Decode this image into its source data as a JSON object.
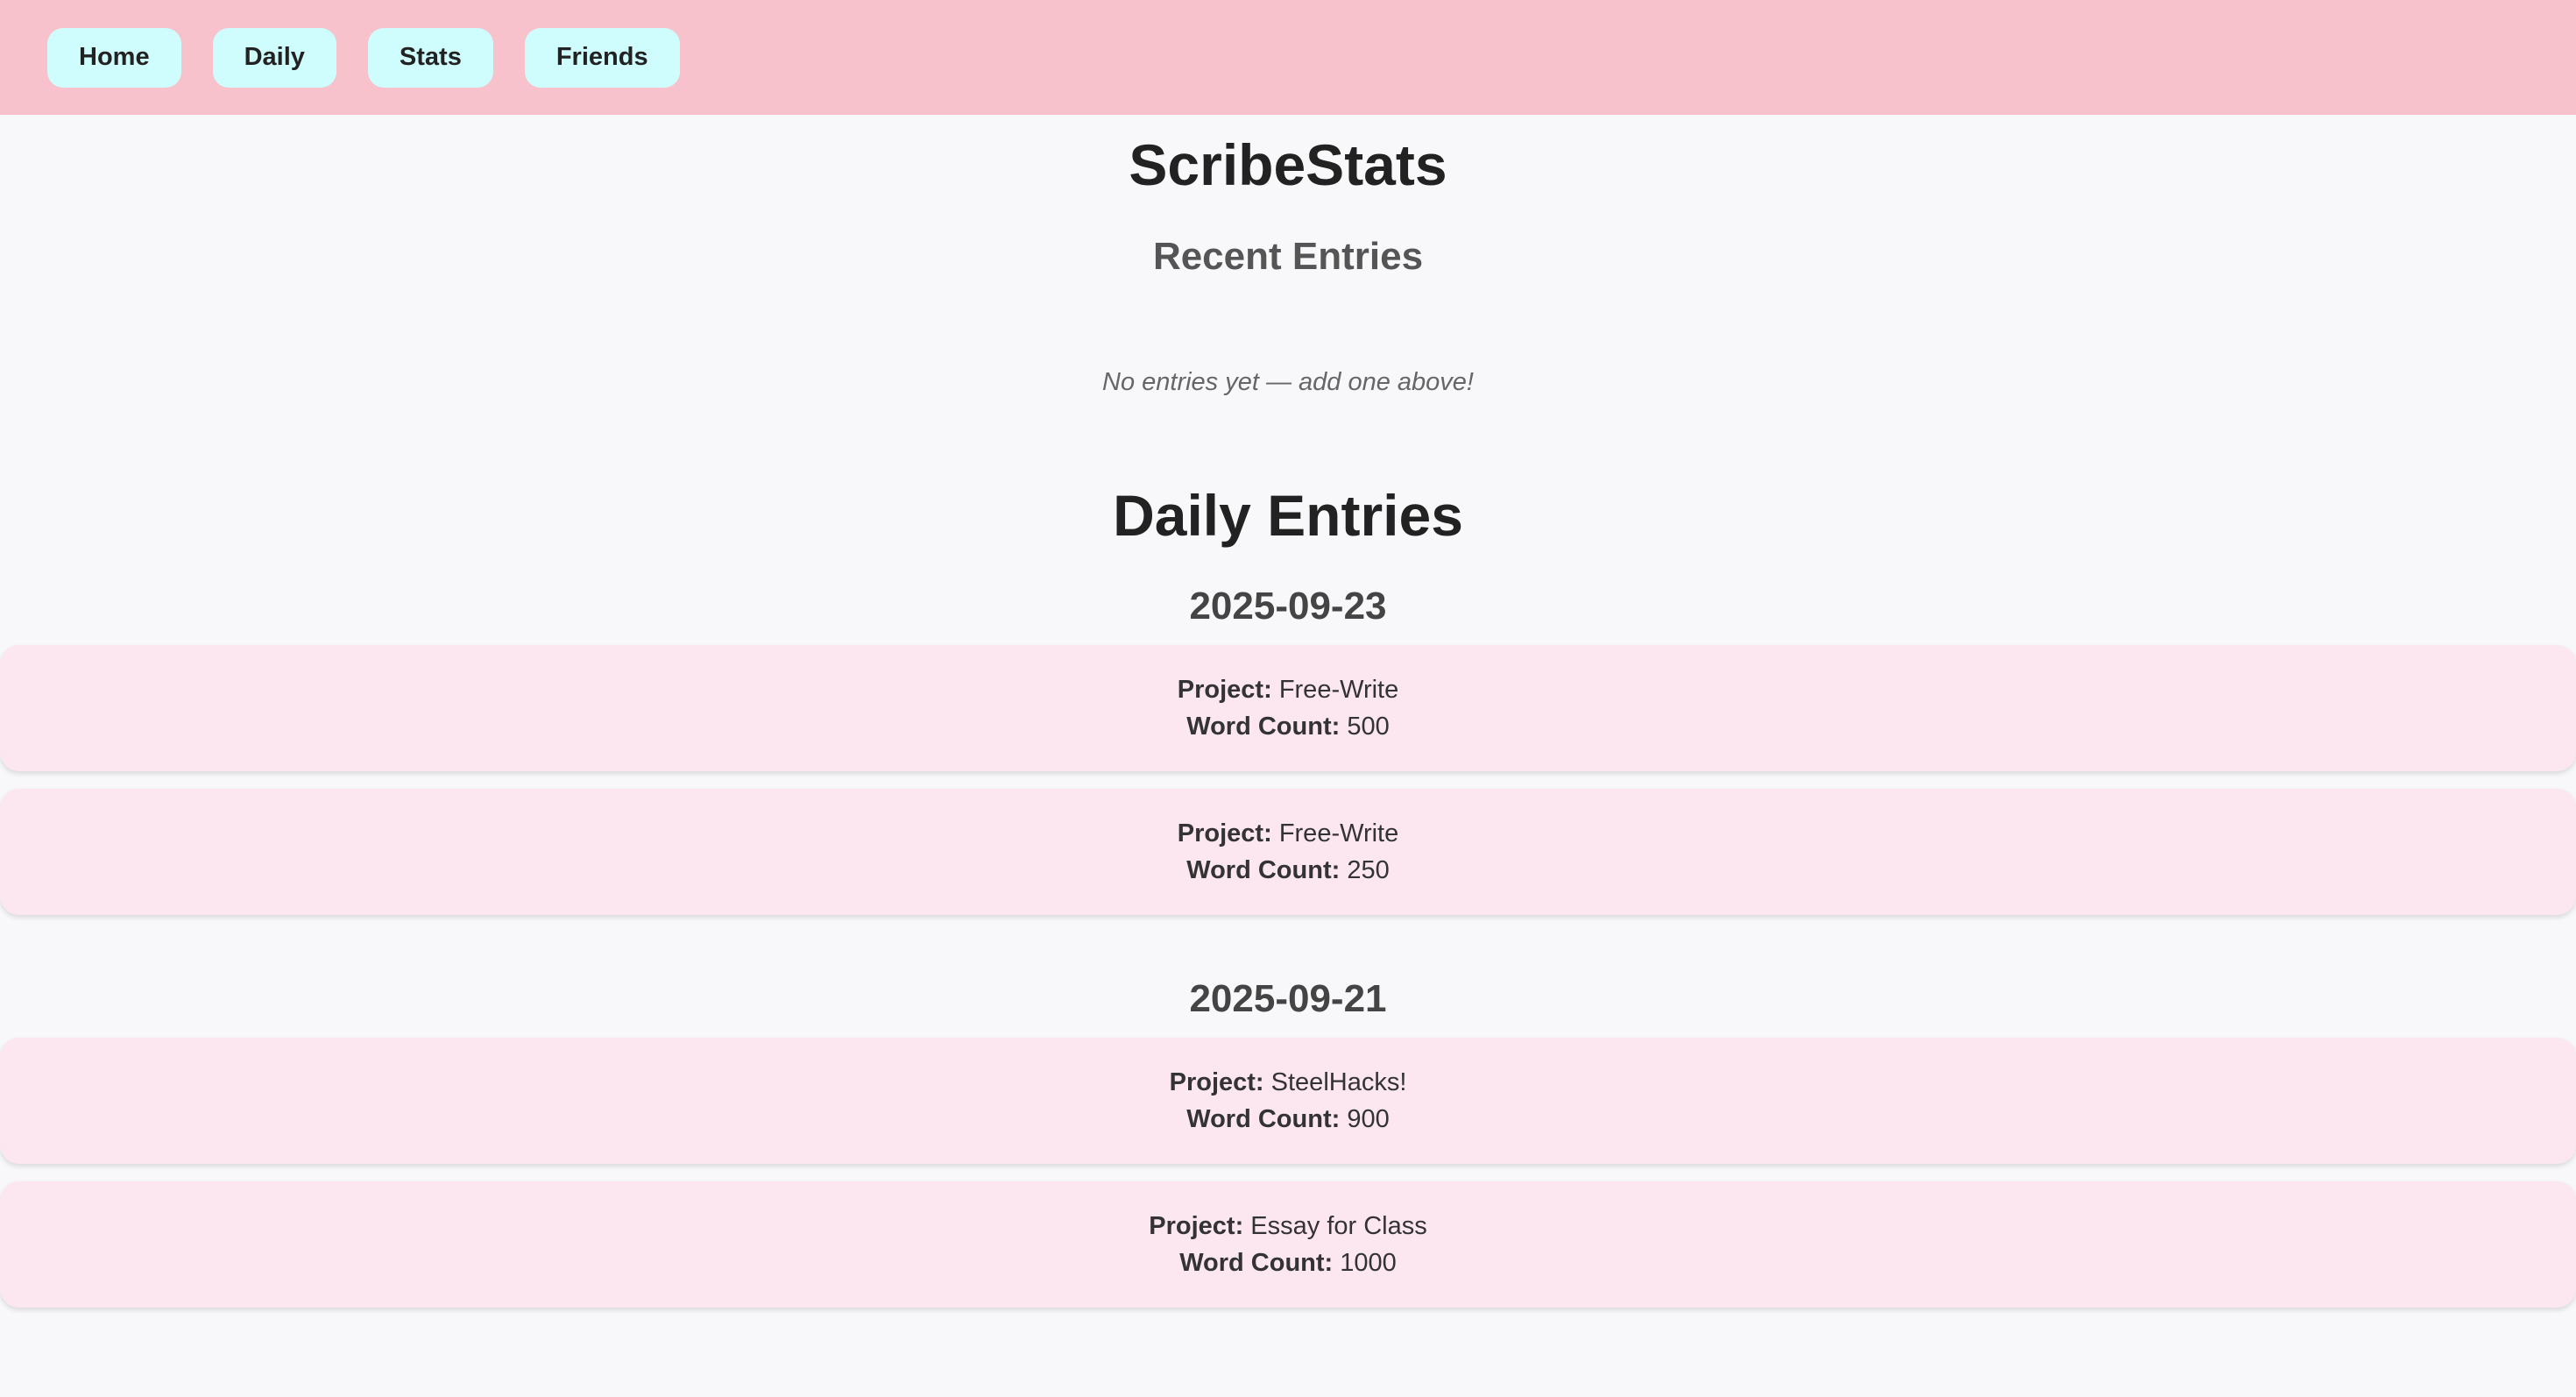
{
  "nav": {
    "items": [
      {
        "label": "Home"
      },
      {
        "label": "Daily"
      },
      {
        "label": "Stats"
      },
      {
        "label": "Friends"
      }
    ]
  },
  "app": {
    "title": "ScribeStats"
  },
  "recent": {
    "title": "Recent Entries",
    "empty_message": "No entries yet — add one above!"
  },
  "daily": {
    "title": "Daily Entries",
    "project_label": "Project:",
    "word_count_label": "Word Count:",
    "groups": [
      {
        "date": "2025-09-23",
        "entries": [
          {
            "project": "Free-Write",
            "word_count": "500"
          },
          {
            "project": "Free-Write",
            "word_count": "250"
          }
        ]
      },
      {
        "date": "2025-09-21",
        "entries": [
          {
            "project": "SteelHacks!",
            "word_count": "900"
          },
          {
            "project": "Essay for Class",
            "word_count": "1000"
          }
        ]
      }
    ]
  },
  "colors": {
    "navbar": "#f7c2cb",
    "nav_button": "#cffcfc",
    "entry_card": "#fce6f0",
    "background": "#f8f8fa"
  }
}
